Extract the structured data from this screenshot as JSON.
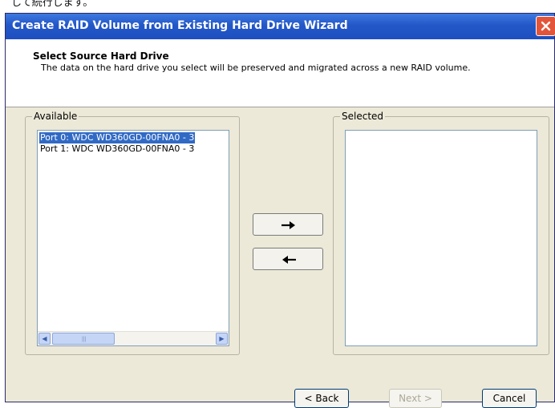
{
  "document": {
    "caption": "して続行します。"
  },
  "window": {
    "title": "Create RAID Volume from Existing Hard Drive Wizard"
  },
  "header": {
    "title": "Select Source Hard Drive",
    "description": "The data on the hard drive you select will be preserved and migrated across a new RAID volume."
  },
  "available": {
    "label": "Available",
    "items": [
      "Port 0: WDC WD360GD-00FNA0 - 3",
      "Port 1: WDC WD360GD-00FNA0 - 3"
    ],
    "selected_index": 0
  },
  "selected": {
    "label": "Selected",
    "items": []
  },
  "buttons": {
    "back": "< Back",
    "next": "Next >",
    "cancel": "Cancel"
  },
  "icons": {
    "close": "close-icon",
    "add": "arrow-right-icon",
    "remove": "arrow-left-icon"
  }
}
